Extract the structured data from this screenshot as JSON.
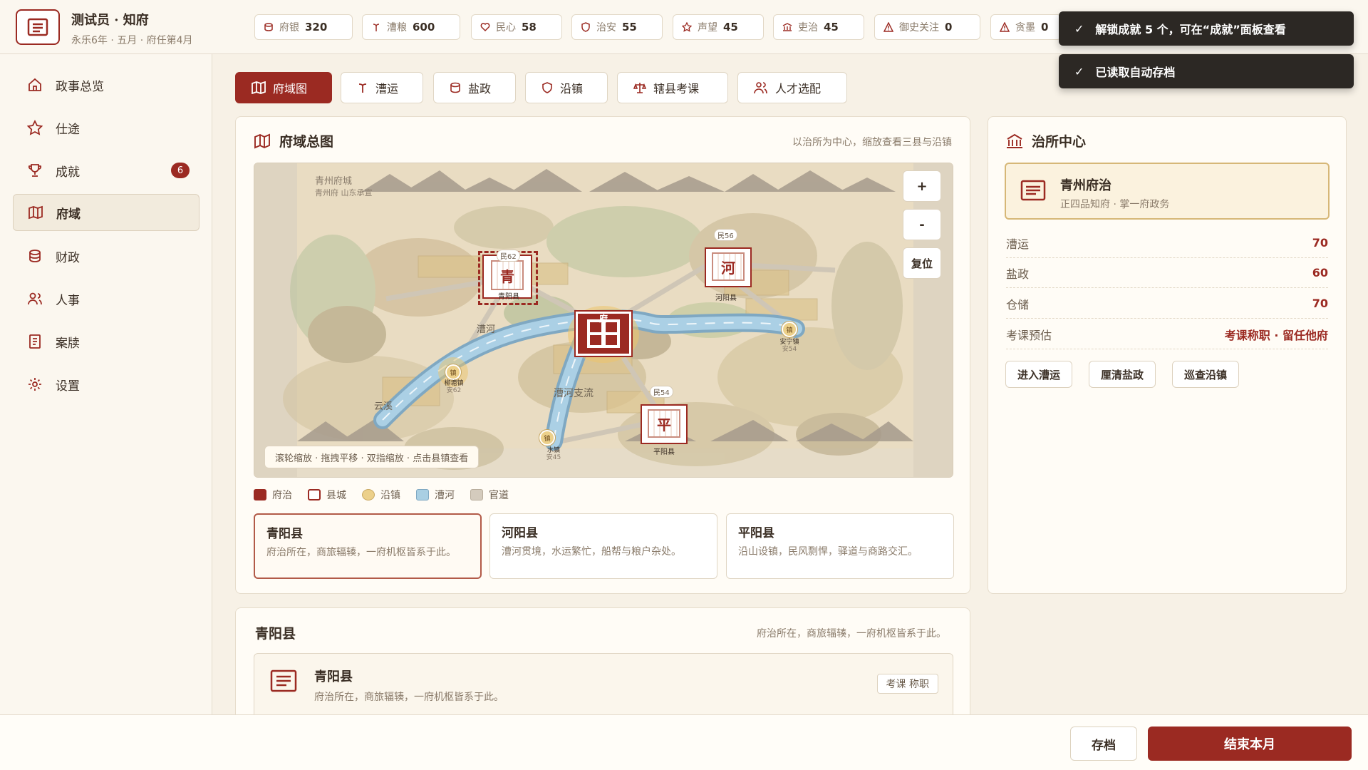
{
  "header": {
    "title": "测试员 · 知府",
    "subtitle": "永乐6年 · 五月 · 府任第4月"
  },
  "stats": [
    {
      "label": "府银",
      "value": "320",
      "icon": "silver-icon"
    },
    {
      "label": "漕粮",
      "value": "600",
      "icon": "grain-icon"
    },
    {
      "label": "民心",
      "value": "58",
      "icon": "heart-icon"
    },
    {
      "label": "治安",
      "value": "55",
      "icon": "shield-icon"
    },
    {
      "label": "声望",
      "value": "45",
      "icon": "star-icon"
    },
    {
      "label": "吏治",
      "value": "45",
      "icon": "building-icon"
    },
    {
      "label": "御史关注",
      "value": "0",
      "icon": "warning-icon"
    },
    {
      "label": "贪墨",
      "value": "0",
      "icon": "warning-icon"
    }
  ],
  "toasts": [
    "解锁成就 5 个，可在“成就”面板查看",
    "已读取自动存档"
  ],
  "sidebar": {
    "items": [
      {
        "label": "政事总览",
        "icon": "home-icon"
      },
      {
        "label": "仕途",
        "icon": "star-icon"
      },
      {
        "label": "成就",
        "icon": "trophy-icon",
        "badge": "6"
      },
      {
        "label": "府域",
        "icon": "map-icon",
        "active": true
      },
      {
        "label": "财政",
        "icon": "coins-icon"
      },
      {
        "label": "人事",
        "icon": "people-icon"
      },
      {
        "label": "案牍",
        "icon": "document-icon"
      },
      {
        "label": "设置",
        "icon": "gear-icon"
      }
    ]
  },
  "tabs": [
    {
      "label": "府域图",
      "icon": "map-icon",
      "active": true
    },
    {
      "label": "漕运",
      "icon": "grain-icon"
    },
    {
      "label": "盐政",
      "icon": "coins-icon"
    },
    {
      "label": "沿镇",
      "icon": "shield-icon"
    },
    {
      "label": "辖县考课",
      "icon": "scale-icon"
    },
    {
      "label": "人才选配",
      "icon": "people-icon"
    }
  ],
  "map_card": {
    "title": "府域总图",
    "hint_right": "以治所为中心，缩放查看三县与沿镇",
    "zoom_in": "+",
    "zoom_out": "-",
    "reset": "复位",
    "map_hint": "滚轮缩放 · 拖拽平移 · 双指缩放 · 点击县镇查看",
    "corner_label_1": "青州府城",
    "corner_label_2": "青州府 山东承宣",
    "nodes": {
      "qing": {
        "glyph": "青",
        "name": "青阳县",
        "tag": "民62"
      },
      "he": {
        "glyph": "河",
        "name": "河阳县",
        "tag": "民56"
      },
      "ping": {
        "glyph": "平",
        "name": "平阳县",
        "tag": "民54"
      },
      "fu": {
        "glyph": "府"
      },
      "town_glyph": "镇",
      "town1": "柳塘镇",
      "town1_sub": "安62",
      "town2": "安宁镇",
      "town2_sub": "安54",
      "town3": "水镇",
      "town3_sub": "安45"
    },
    "river_label_1": "漕河",
    "river_label_2": "漕河支流",
    "river_label_3": "云溪"
  },
  "legend": [
    {
      "label": "府治",
      "color": "#9b2a22",
      "style": "fill"
    },
    {
      "label": "县城",
      "color": "#9b2a22",
      "style": "outline"
    },
    {
      "label": "沿镇",
      "color": "#ecd08a",
      "style": "round"
    },
    {
      "label": "漕河",
      "color": "#a9cfe3",
      "style": "fill"
    },
    {
      "label": "官道",
      "color": "#d4cbbd",
      "style": "fill"
    }
  ],
  "counties": [
    {
      "name": "青阳县",
      "desc": "府治所在，商旅辐辏，一府机枢皆系于此。",
      "active": true
    },
    {
      "name": "河阳县",
      "desc": "漕河贯境，水运繁忙，船帮与粮户杂处。"
    },
    {
      "name": "平阳县",
      "desc": "沿山设镇，民风剽悍，驿道与商路交汇。"
    }
  ],
  "detail_card": {
    "title": "青阳县",
    "hint_right": "府治所在，商旅辐辏，一府机枢皆系于此。",
    "inner_name": "青阳县",
    "inner_desc": "府治所在，商旅辐辏，一府机枢皆系于此。",
    "rating": "考课 称职"
  },
  "center_card": {
    "title": "治所中心",
    "seat_name": "青州府治",
    "seat_desc": "正四品知府 · 掌一府政务",
    "rows": [
      {
        "label": "漕运",
        "value": "70"
      },
      {
        "label": "盐政",
        "value": "60"
      },
      {
        "label": "仓储",
        "value": "70"
      },
      {
        "label": "考课预估",
        "value": "考课称职 · 留任他府"
      }
    ],
    "actions": [
      "进入漕运",
      "厘清盐政",
      "巡查沿镇"
    ]
  },
  "bottom": {
    "save": "存档",
    "end_month": "结束本月"
  },
  "colors": {
    "accent": "#9b2a22",
    "background": "#f7f1e6",
    "river": "#a9cfe3"
  }
}
